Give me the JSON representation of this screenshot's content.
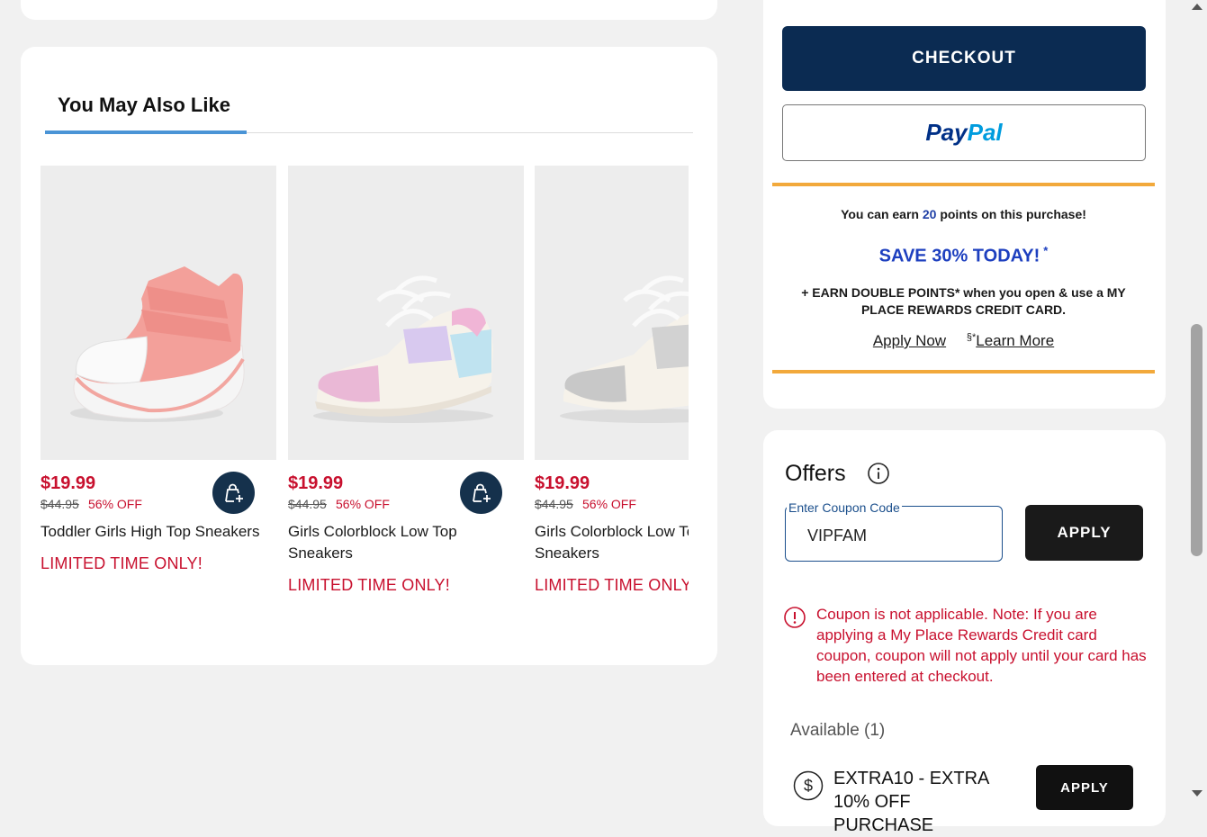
{
  "recommendations": {
    "tab_label": "You May Also Like",
    "products": [
      {
        "price": "$19.99",
        "was_price": "$44.95",
        "discount": "56% OFF",
        "name": "Toddler Girls High Top Sneakers",
        "promo": "LIMITED TIME ONLY!"
      },
      {
        "price": "$19.99",
        "was_price": "$44.95",
        "discount": "56% OFF",
        "name": "Girls Colorblock Low Top Sneakers",
        "promo": "LIMITED TIME ONLY!"
      },
      {
        "price": "$19.99",
        "was_price": "$44.95",
        "discount": "56% OFF",
        "name": "Girls Colorblock Low Top Sneakers",
        "promo": "LIMITED TIME ONLY!"
      }
    ],
    "add_to_bag_icon": "bag-plus-icon"
  },
  "checkout": {
    "checkout_label": "CHECKOUT",
    "paypal_part1": "Pay",
    "paypal_part2": "Pal"
  },
  "rewards": {
    "earn_prefix": "You can earn ",
    "points": "20",
    "earn_suffix": " points on this purchase!",
    "save_headline": "SAVE 30% TODAY!",
    "save_marker": "*",
    "double_points": "+ EARN DOUBLE POINTS* when you open & use a MY PLACE REWARDS CREDIT CARD.",
    "apply_now": "Apply Now",
    "section_mark": "§*",
    "learn_more": "Learn More"
  },
  "offers": {
    "title": "Offers",
    "coupon_label": "Enter Coupon Code",
    "coupon_value": "VIPFAM",
    "apply_label": "APPLY",
    "error_message": "Coupon is not applicable. Note: If you are applying a My Place Rewards Credit card coupon, coupon will not apply until your card has been entered at checkout.",
    "available_label": "Available (1)",
    "available_coupon_name": "EXTRA10 - EXTRA 10% OFF PURCHASE",
    "available_apply_label": "APPLY"
  },
  "colors": {
    "sale_red": "#c8102e",
    "checkout_navy": "#0b2b52",
    "rewards_orange": "#f2a93b",
    "tab_blue": "#4a94d6"
  }
}
